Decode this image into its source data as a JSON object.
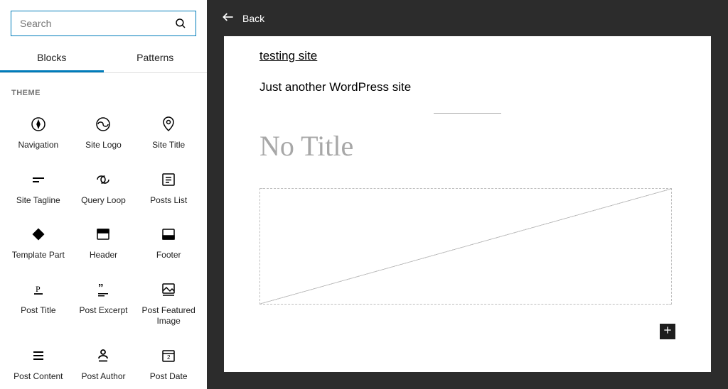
{
  "sidebar": {
    "search_placeholder": "Search",
    "tabs": [
      {
        "label": "Blocks",
        "active": true
      },
      {
        "label": "Patterns",
        "active": false
      }
    ],
    "section_title": "THEME",
    "blocks": [
      {
        "label": "Navigation",
        "icon": "compass"
      },
      {
        "label": "Site Logo",
        "icon": "logo-circle"
      },
      {
        "label": "Site Title",
        "icon": "map-pin"
      },
      {
        "label": "Site Tagline",
        "icon": "tagline"
      },
      {
        "label": "Query Loop",
        "icon": "loop"
      },
      {
        "label": "Posts List",
        "icon": "posts-list"
      },
      {
        "label": "Template Part",
        "icon": "template-part"
      },
      {
        "label": "Header",
        "icon": "header"
      },
      {
        "label": "Footer",
        "icon": "footer"
      },
      {
        "label": "Post Title",
        "icon": "post-title"
      },
      {
        "label": "Post Excerpt",
        "icon": "quote"
      },
      {
        "label": "Post Featured Image",
        "icon": "featured-image"
      },
      {
        "label": "Post Content",
        "icon": "post-content"
      },
      {
        "label": "Post Author",
        "icon": "author"
      },
      {
        "label": "Post Date",
        "icon": "calendar"
      }
    ]
  },
  "topbar": {
    "back_label": "Back"
  },
  "canvas": {
    "site_name": "testing site",
    "tagline": "Just another WordPress site",
    "page_title": "No Title"
  }
}
